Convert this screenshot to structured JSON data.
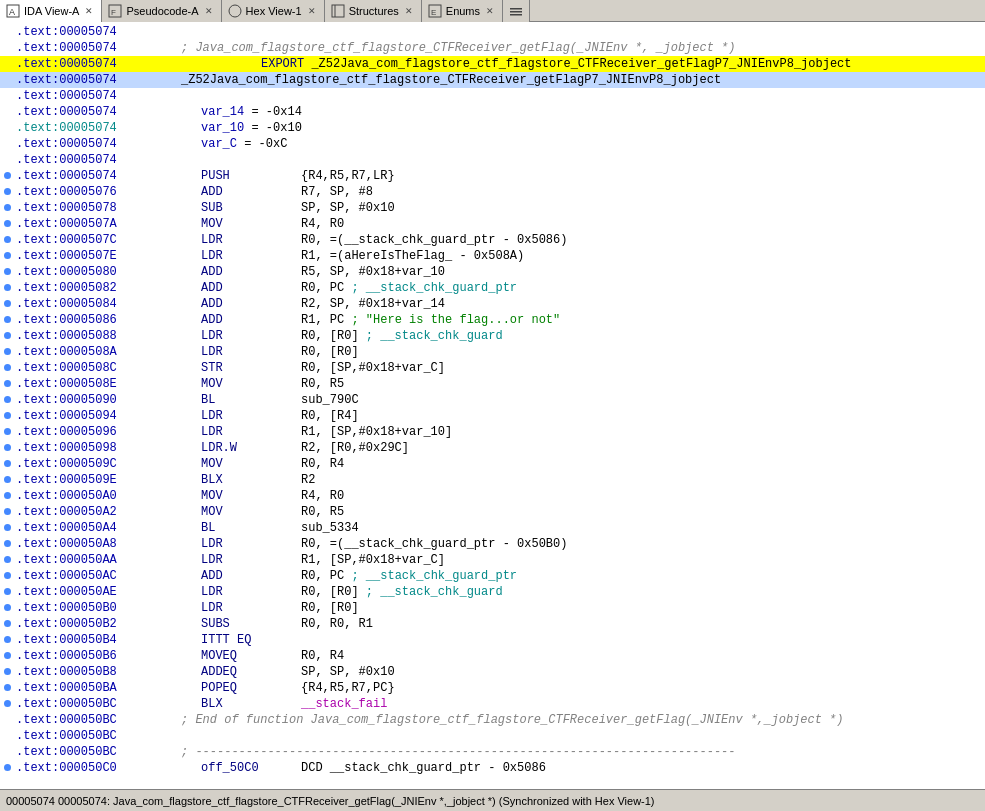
{
  "tabs": [
    {
      "id": "ida-view-a",
      "icon": "A",
      "label": "IDA View-A",
      "active": true,
      "closeable": true
    },
    {
      "id": "pseudocode-a",
      "icon": "P",
      "label": "Pseudocode-A",
      "active": false,
      "closeable": true
    },
    {
      "id": "hex-view-1",
      "icon": "H",
      "label": "Hex View-1",
      "active": false,
      "closeable": true
    },
    {
      "id": "structures",
      "icon": "S",
      "label": "Structures",
      "active": false,
      "closeable": true
    },
    {
      "id": "enums",
      "icon": "E",
      "label": "Enums",
      "active": false,
      "closeable": true
    },
    {
      "id": "extra",
      "icon": "≡",
      "label": "",
      "active": false,
      "closeable": false
    }
  ],
  "code_lines": [
    {
      "addr": ".text:00005074",
      "dot": false,
      "content": "",
      "highlight": "none"
    },
    {
      "addr": ".text:00005074",
      "dot": false,
      "content": "; Java_com_flagstore_ctf_flagstore_CTFReceiver_getFlag(_JNIEnv *, _jobject *)",
      "highlight": "none",
      "comment": true
    },
    {
      "addr": ".text:00005074",
      "dot": false,
      "content": "            EXPORT  _Z52Java_com_flagstore_ctf_flagstore_CTFReceiver_getFlagP7_JNIEnvP8_jobject",
      "highlight": "yellow"
    },
    {
      "addr": ".text:00005074",
      "dot": false,
      "content": "_Z52Java_com_flagstore_ctf_flagstore_CTFReceiver_getFlagP7_JNIEnvP8_jobject",
      "highlight": "blue"
    },
    {
      "addr": ".text:00005074",
      "dot": false,
      "content": "",
      "highlight": "none"
    },
    {
      "addr": ".text:00005074",
      "dot": false,
      "content": "var_14          = -0x14",
      "highlight": "none",
      "var": true
    },
    {
      "addr": ".text:00005074",
      "dot": false,
      "content": "var_10          = -0x10",
      "highlight": "none",
      "var": true,
      "cyan_addr": true
    },
    {
      "addr": ".text:00005074",
      "dot": false,
      "content": "var_C           = -0xC",
      "highlight": "none",
      "var": true
    },
    {
      "addr": ".text:00005074",
      "dot": false,
      "content": "",
      "highlight": "none"
    },
    {
      "addr": ".text:00005074",
      "dot": true,
      "instr": "PUSH",
      "operands": "{R4,R5,R7,LR}",
      "highlight": "none"
    },
    {
      "addr": ".text:00005076",
      "dot": true,
      "instr": "ADD",
      "operands": "R7, SP, #8",
      "highlight": "none"
    },
    {
      "addr": ".text:00005078",
      "dot": true,
      "instr": "SUB",
      "operands": "SP, SP, #0x10",
      "highlight": "none"
    },
    {
      "addr": ".text:0000507A",
      "dot": true,
      "instr": "MOV",
      "operands": "R4, R0",
      "highlight": "none"
    },
    {
      "addr": ".text:0000507C",
      "dot": true,
      "instr": "LDR",
      "operands": "R0, =(__stack_chk_guard_ptr - 0x5086)",
      "highlight": "none"
    },
    {
      "addr": ".text:0000507E",
      "dot": true,
      "instr": "LDR",
      "operands": "R1, =(aHereIsTheFlag_ - 0x508A)",
      "highlight": "none"
    },
    {
      "addr": ".text:00005080",
      "dot": true,
      "instr": "ADD",
      "operands": "R5, SP, #0x18+var_10",
      "highlight": "none"
    },
    {
      "addr": ".text:00005082",
      "dot": true,
      "instr": "ADD",
      "operands": "R0, PC ; __stack_chk_guard_ptr",
      "highlight": "none",
      "has_comment_cyan": true
    },
    {
      "addr": ".text:00005084",
      "dot": true,
      "instr": "ADD",
      "operands": "R2, SP, #0x18+var_14",
      "highlight": "none"
    },
    {
      "addr": ".text:00005086",
      "dot": true,
      "instr": "ADD",
      "operands": "R1, PC  ; \"Here is the flag...or not\"",
      "highlight": "none",
      "has_comment_str": true
    },
    {
      "addr": ".text:00005088",
      "dot": true,
      "instr": "LDR",
      "operands": "R0, [R0] ; __stack_chk_guard",
      "highlight": "none",
      "has_comment_cyan": true
    },
    {
      "addr": ".text:0000508A",
      "dot": true,
      "instr": "LDR",
      "operands": "R0, [R0]",
      "highlight": "none"
    },
    {
      "addr": ".text:0000508C",
      "dot": true,
      "instr": "STR",
      "operands": "R0, [SP,#0x18+var_C]",
      "highlight": "none"
    },
    {
      "addr": ".text:0000508E",
      "dot": true,
      "instr": "MOV",
      "operands": "R0, R5",
      "highlight": "none"
    },
    {
      "addr": ".text:00005090",
      "dot": true,
      "instr": "BL",
      "operands": "sub_790C",
      "highlight": "none"
    },
    {
      "addr": ".text:00005094",
      "dot": true,
      "instr": "LDR",
      "operands": "R0, [R4]",
      "highlight": "none"
    },
    {
      "addr": ".text:00005096",
      "dot": true,
      "instr": "LDR",
      "operands": "R1, [SP,#0x18+var_10]",
      "highlight": "none"
    },
    {
      "addr": ".text:00005098",
      "dot": true,
      "instr": "LDR.W",
      "operands": "R2, [R0,#0x29C]",
      "highlight": "none"
    },
    {
      "addr": ".text:0000509C",
      "dot": true,
      "instr": "MOV",
      "operands": "R0, R4",
      "highlight": "none"
    },
    {
      "addr": ".text:0000509E",
      "dot": true,
      "instr": "BLX",
      "operands": "R2",
      "highlight": "none"
    },
    {
      "addr": ".text:000050A0",
      "dot": true,
      "instr": "MOV",
      "operands": "R4, R0",
      "highlight": "none"
    },
    {
      "addr": ".text:000050A2",
      "dot": true,
      "instr": "MOV",
      "operands": "R0, R5",
      "highlight": "none"
    },
    {
      "addr": ".text:000050A4",
      "dot": true,
      "instr": "BL",
      "operands": "sub_5334",
      "highlight": "none"
    },
    {
      "addr": ".text:000050A8",
      "dot": true,
      "instr": "LDR",
      "operands": "R0, =(__stack_chk_guard_ptr - 0x50B0)",
      "highlight": "none"
    },
    {
      "addr": ".text:000050AA",
      "dot": true,
      "instr": "LDR",
      "operands": "R1, [SP,#0x18+var_C]",
      "highlight": "none"
    },
    {
      "addr": ".text:000050AC",
      "dot": true,
      "instr": "ADD",
      "operands": "R0, PC ; __stack_chk_guard_ptr",
      "highlight": "none",
      "has_comment_cyan": true
    },
    {
      "addr": ".text:000050AE",
      "dot": true,
      "instr": "LDR",
      "operands": "R0, [R0] ; __stack_chk_guard",
      "highlight": "none",
      "has_comment_cyan": true
    },
    {
      "addr": ".text:000050B0",
      "dot": true,
      "instr": "LDR",
      "operands": "R0, [R0]",
      "highlight": "none"
    },
    {
      "addr": ".text:000050B2",
      "dot": true,
      "instr": "SUBS",
      "operands": "R0, R0, R1",
      "highlight": "none"
    },
    {
      "addr": ".text:000050B4",
      "dot": true,
      "instr": "ITTT EQ",
      "operands": "",
      "highlight": "none"
    },
    {
      "addr": ".text:000050B6",
      "dot": true,
      "instr": "MOVEQ",
      "operands": "R0, R4",
      "highlight": "none"
    },
    {
      "addr": ".text:000050B8",
      "dot": true,
      "instr": "ADDEQ",
      "operands": "SP, SP, #0x10",
      "highlight": "none"
    },
    {
      "addr": ".text:000050BA",
      "dot": true,
      "instr": "POPEQ",
      "operands": "{R4,R5,R7,PC}",
      "highlight": "none"
    },
    {
      "addr": ".text:000050BC",
      "dot": true,
      "instr": "BLX",
      "operands": "__stack_fail",
      "highlight": "none",
      "stack_fail": true
    },
    {
      "addr": ".text:000050BC",
      "dot": false,
      "content": "; End of function Java_com_flagstore_ctf_flagstore_CTFReceiver_getFlag(_JNIEnv *,_jobject *)",
      "highlight": "none",
      "comment": true
    },
    {
      "addr": ".text:000050BC",
      "dot": false,
      "content": "",
      "highlight": "none"
    },
    {
      "addr": ".text:000050BC",
      "dot": false,
      "content": "; ---------------------------------------------------------------------------",
      "highlight": "none",
      "comment": true
    },
    {
      "addr": ".text:000050C0",
      "dot": true,
      "instr": "off_50C0",
      "operands": "DCD __stack_chk_guard_ptr - 0x5086",
      "highlight": "none"
    }
  ],
  "status_bar": "00005074 00005074: Java_com_flagstore_ctf_flagstore_CTFReceiver_getFlag(_JNIEnv *,_jobject *)  (Synchronized with Hex View-1)"
}
